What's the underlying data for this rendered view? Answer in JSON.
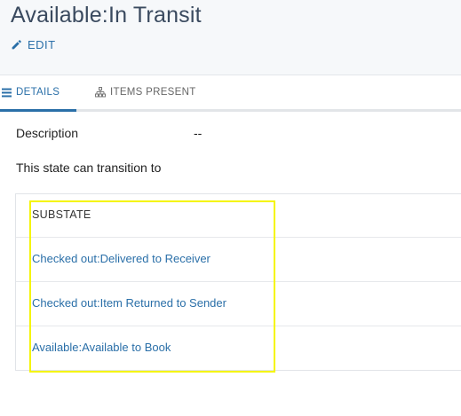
{
  "header": {
    "title": "Available:In Transit",
    "edit_label": "EDIT"
  },
  "tabs": [
    {
      "label": "DETAILS",
      "icon": "list-icon",
      "active": true
    },
    {
      "label": "ITEMS PRESENT",
      "icon": "sitemap-icon",
      "active": false
    }
  ],
  "details": {
    "description_label": "Description",
    "description_value": "--",
    "transition_text": "This state can transition to"
  },
  "substate_table": {
    "header": "SUBSTATE",
    "rows": [
      "Checked out:Delivered to Receiver",
      "Checked out:Item Returned to Sender",
      "Available:Available to Book"
    ]
  },
  "colors": {
    "accent": "#2a6fa8",
    "highlight": "#f5f500",
    "header_bg": "#f6f8fa"
  }
}
